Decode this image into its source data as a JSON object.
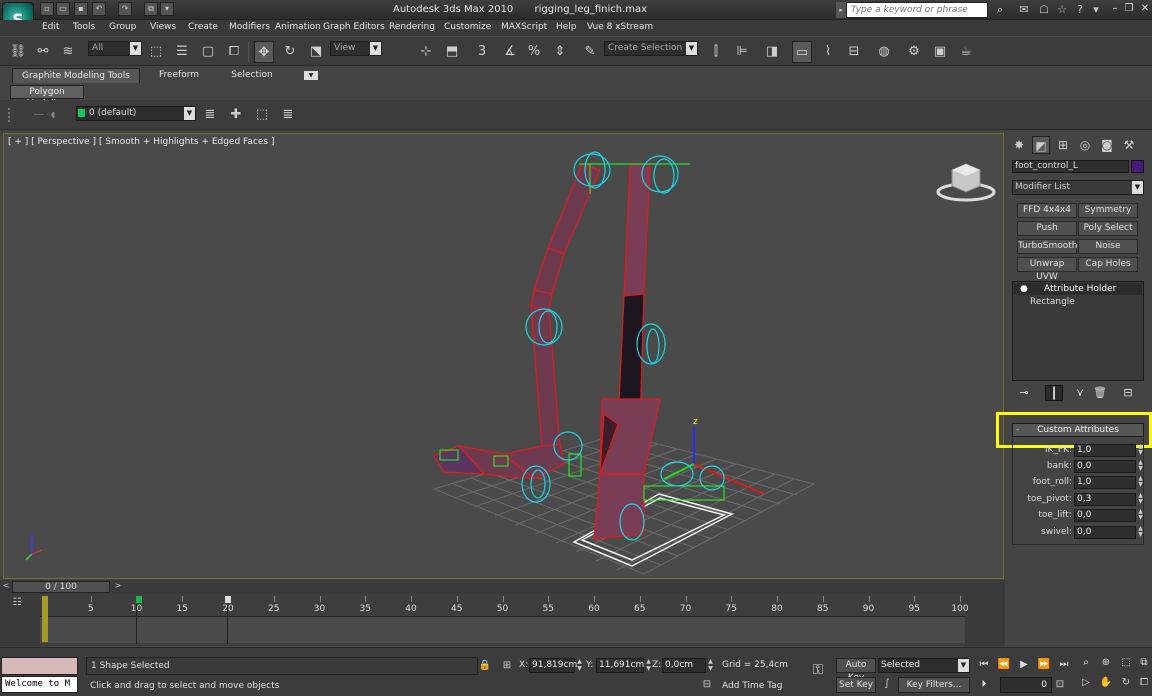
{
  "window": {
    "app_title": "Autodesk 3ds Max  2010",
    "file_name": "rigging_leg_finich.max",
    "search_placeholder": "Type a keyword or phrase",
    "logo_letter": "S"
  },
  "menu": [
    "Edit",
    "Tools",
    "Group",
    "Views",
    "Create",
    "Modifiers",
    "Animation",
    "Graph Editors",
    "Rendering",
    "Customize",
    "MAXScript",
    "Help",
    "Vue 8 xStream"
  ],
  "toolbar": {
    "filter_value": "All",
    "refcoord_value": "View",
    "selection_set_placeholder": "Create Selection Se",
    "snap_label": "3"
  },
  "ribbon": {
    "tabs": [
      "Graphite Modeling Tools",
      "Freeform",
      "Selection"
    ],
    "subtab": "Polygon Modeling"
  },
  "layer": {
    "current_layer": "0 (default)"
  },
  "viewport": {
    "label": "[ + ] [ Perspective ] [ Smooth + Highlights + Edged Faces ]",
    "axis_z": "z"
  },
  "command_panel": {
    "object_name": "foot_control_L",
    "object_color": "#4a1a7a",
    "modifier_list": "Modifier List",
    "modifier_buttons": [
      "FFD 4x4x4",
      "Symmetry",
      "Push",
      "Poly Select",
      "TurboSmooth",
      "Noise",
      "Unwrap UVW",
      "Cap Holes"
    ],
    "stack": [
      "Attribute Holder",
      "Rectangle"
    ],
    "rollout_title": "Custom Attributes",
    "params": [
      {
        "label": "IK_FK:",
        "value": "1,0"
      },
      {
        "label": "bank:",
        "value": "0,0"
      },
      {
        "label": "foot_roll:",
        "value": "1,0"
      },
      {
        "label": "toe_pivot:",
        "value": "0,3"
      },
      {
        "label": "toe_lift:",
        "value": "0,0"
      },
      {
        "label": "swivel:",
        "value": "0,0"
      }
    ]
  },
  "timeline": {
    "slider_label": "0 / 100",
    "ticks": [
      "0",
      "5",
      "10",
      "15",
      "20",
      "25",
      "30",
      "35",
      "40",
      "45",
      "50",
      "55",
      "60",
      "65",
      "70",
      "75",
      "80",
      "85",
      "90",
      "95",
      "100"
    ]
  },
  "status": {
    "listener_text": "Welcome to M",
    "selection": "1 Shape Selected",
    "prompt": "Click and drag to select and move objects",
    "x_label": "X:",
    "x_value": "91,819cm",
    "y_label": "Y:",
    "y_value": "11,691cm",
    "z_label": "Z:",
    "z_value": "0,0cm",
    "grid": "Grid = 25,4cm",
    "add_time_tag": "Add Time Tag",
    "auto_key": "Auto Key",
    "set_key": "Set Key",
    "key_mode": "Selected",
    "key_filters": "Key Filters...",
    "current_frame": "0"
  }
}
